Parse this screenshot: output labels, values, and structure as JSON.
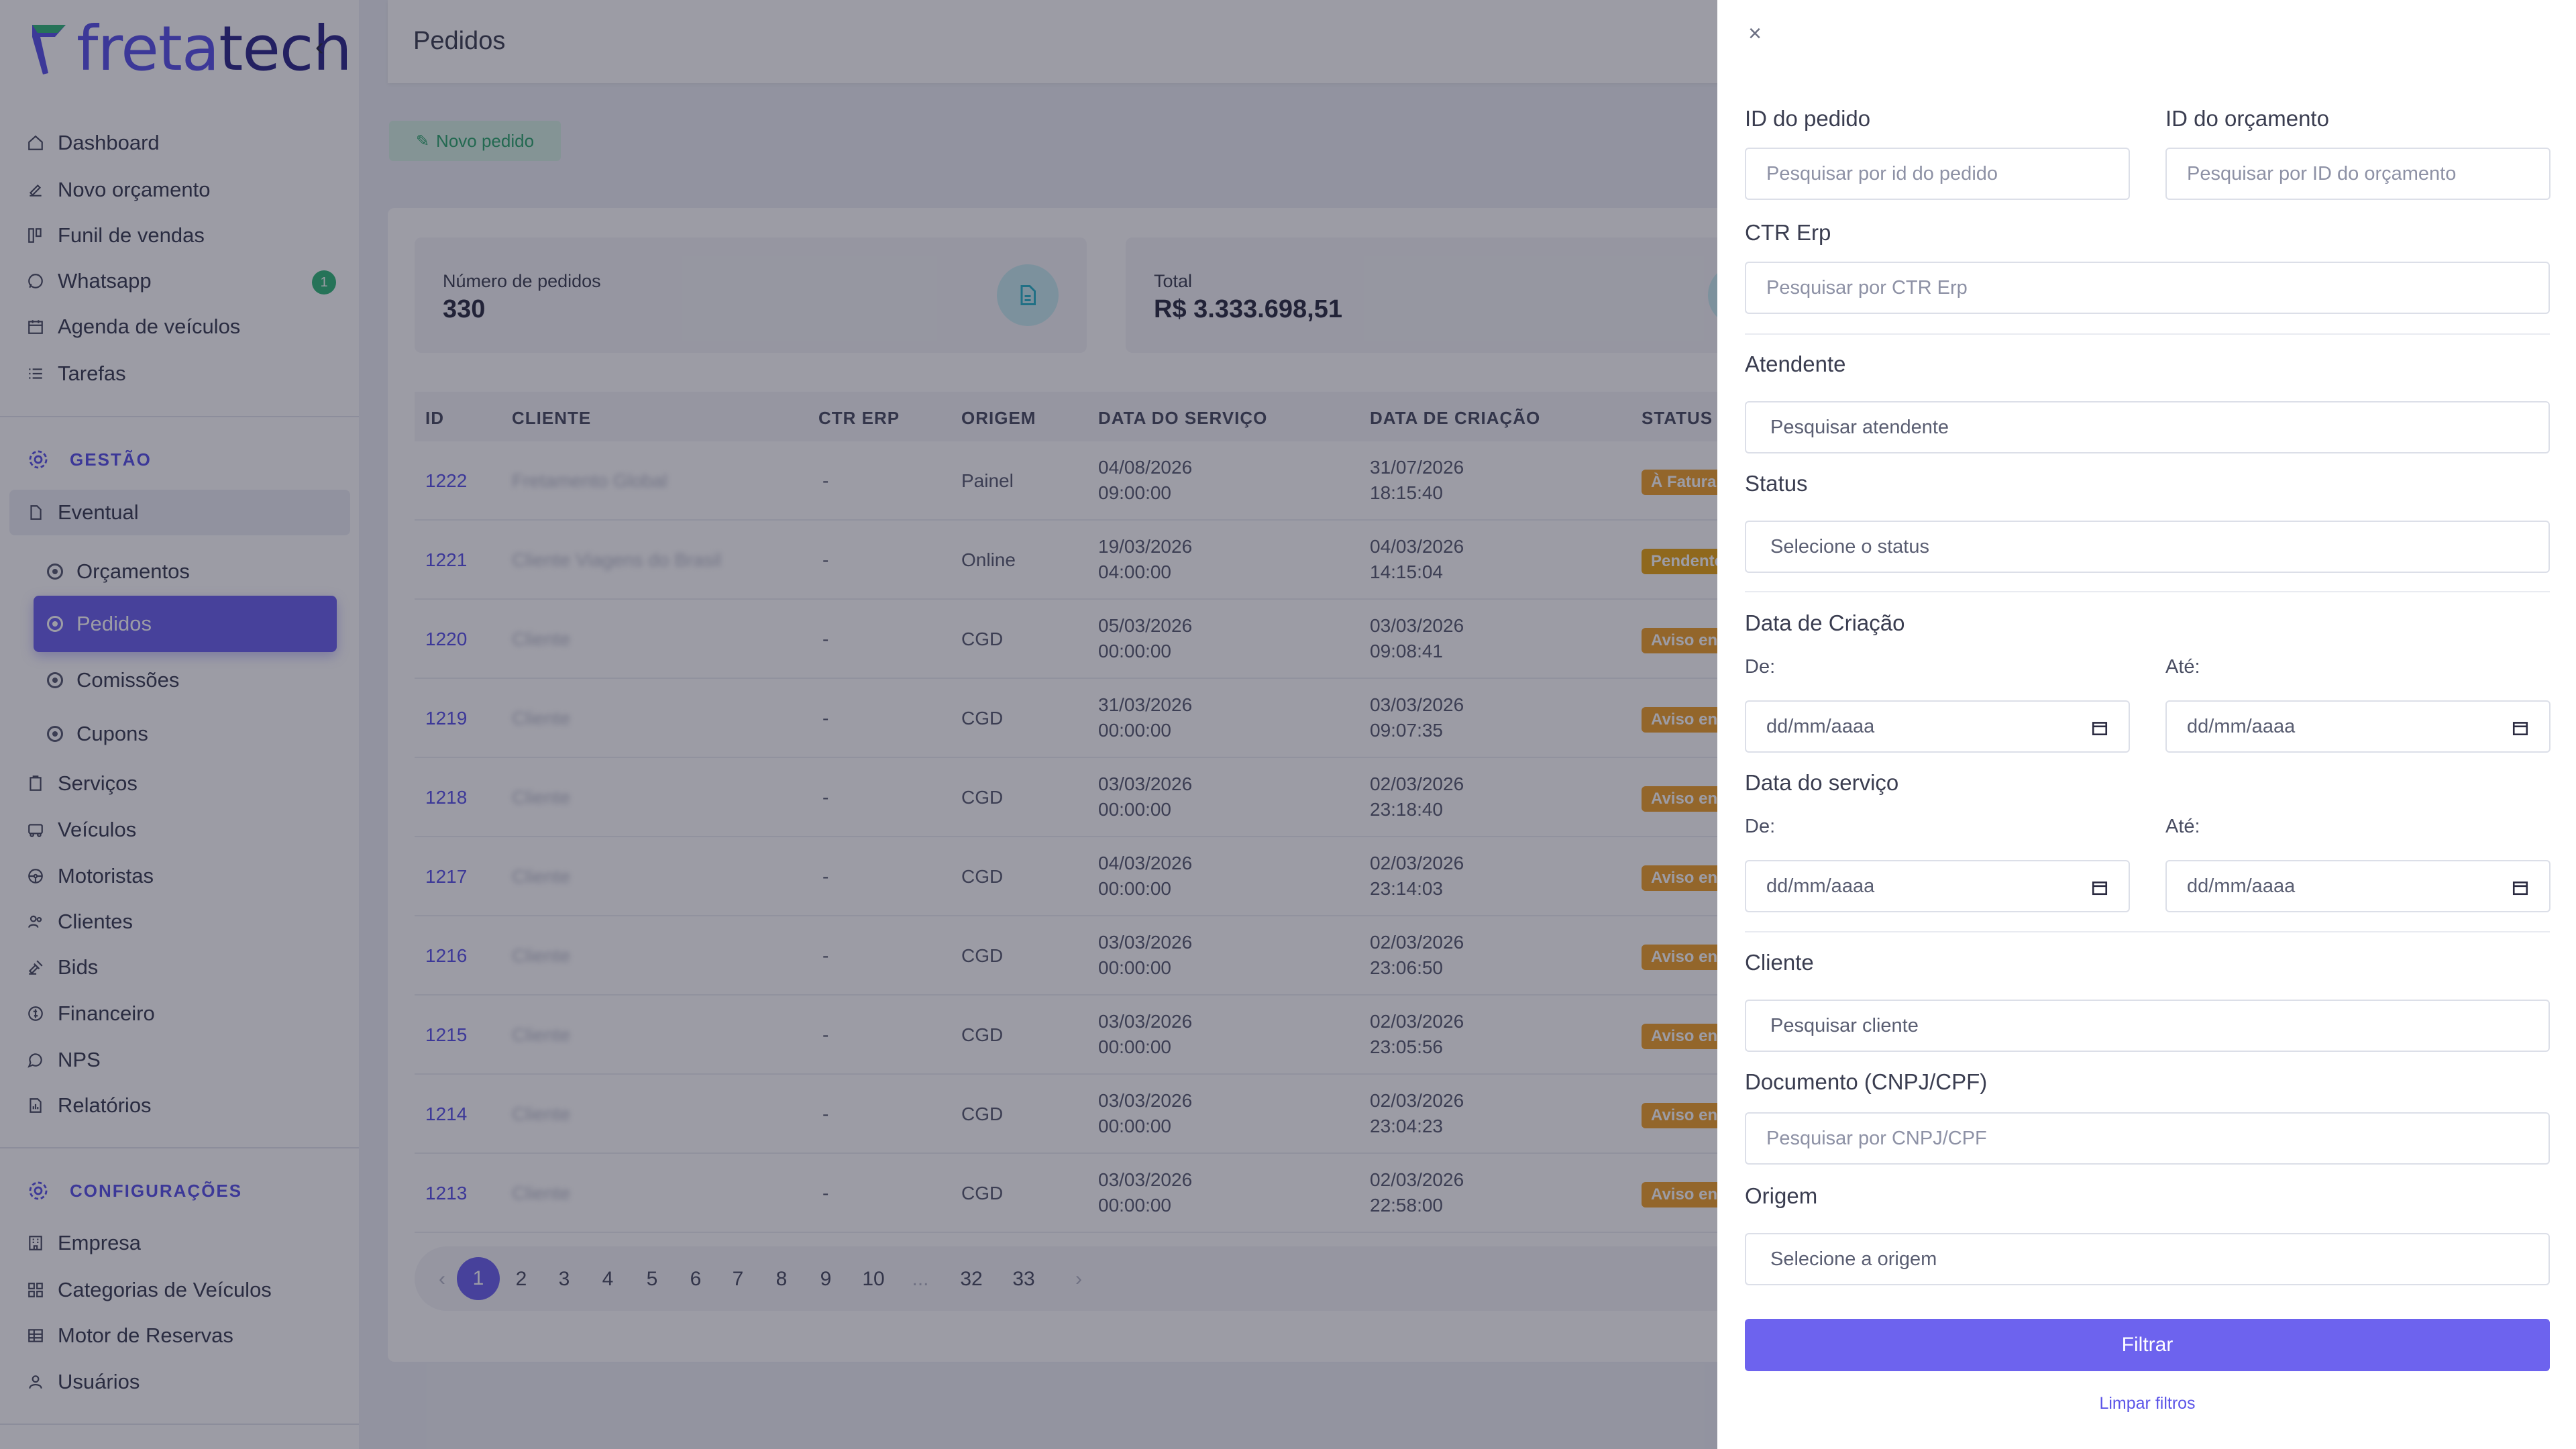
{
  "brand": {
    "name_part1": "freta",
    "name_part2": "tech",
    "colors": {
      "primary": "#5b54e8",
      "primary_dark": "#2f2a8a",
      "accent_green": "#35b87a",
      "status_orange": "#f0a22e",
      "status_yellow": "#e9a516"
    }
  },
  "sidebar": {
    "items": [
      {
        "label": "Dashboard",
        "icon": "home-icon"
      },
      {
        "label": "Novo orçamento",
        "icon": "edit-icon"
      },
      {
        "label": "Funil de vendas",
        "icon": "funnel-icon"
      },
      {
        "label": "Whatsapp",
        "icon": "whatsapp-icon",
        "badge": "1"
      },
      {
        "label": "Agenda de veículos",
        "icon": "calendar-icon"
      },
      {
        "label": "Tarefas",
        "icon": "list-icon"
      }
    ],
    "gestao_title": "GESTÃO",
    "eventual_label": "Eventual",
    "eventual_sub": [
      {
        "label": "Orçamentos"
      },
      {
        "label": "Pedidos",
        "active": true
      },
      {
        "label": "Comissões"
      },
      {
        "label": "Cupons"
      }
    ],
    "gestao_items": [
      {
        "label": "Serviços",
        "icon": "clipboard-icon"
      },
      {
        "label": "Veículos",
        "icon": "bus-icon"
      },
      {
        "label": "Motoristas",
        "icon": "steering-wheel-icon"
      },
      {
        "label": "Clientes",
        "icon": "users-icon"
      },
      {
        "label": "Bids",
        "icon": "gavel-icon"
      },
      {
        "label": "Financeiro",
        "icon": "coin-icon"
      },
      {
        "label": "NPS",
        "icon": "chat-icon"
      },
      {
        "label": "Relatórios",
        "icon": "report-icon"
      }
    ],
    "config_title": "CONFIGURAÇÕES",
    "config_items": [
      {
        "label": "Empresa",
        "icon": "building-icon"
      },
      {
        "label": "Categorias de Veículos",
        "icon": "grid-icon"
      },
      {
        "label": "Motor de Reservas",
        "icon": "table-icon"
      },
      {
        "label": "Usuários",
        "icon": "user-icon"
      }
    ]
  },
  "main": {
    "page_title": "Pedidos",
    "new_order_label": "Novo pedido",
    "stats": [
      {
        "label": "Número de pedidos",
        "value": "330"
      },
      {
        "label": "Total",
        "value": "R$ 3.333.698,51"
      }
    ],
    "columns": [
      "ID",
      "CLIENTE",
      "CTR ERP",
      "ORIGEM",
      "DATA DO SERVIÇO",
      "DATA DE CRIAÇÃO",
      "STATUS"
    ],
    "rows": [
      {
        "id": "1222",
        "client": "Fretamento Global",
        "ctr": "-",
        "origin": "Painel",
        "service_date": "04/08/2026",
        "service_time": "09:00:00",
        "created_date": "31/07/2026",
        "created_time": "18:15:40",
        "status": "À Faturar",
        "status_color": "#f0a22e"
      },
      {
        "id": "1221",
        "client": "Cliente Viagens do Brasil",
        "ctr": "-",
        "origin": "Online",
        "service_date": "19/03/2026",
        "service_time": "04:00:00",
        "created_date": "04/03/2026",
        "created_time": "14:15:04",
        "status": "Pendente",
        "status_color": "#e9a516"
      },
      {
        "id": "1220",
        "client": "Cliente",
        "ctr": "-",
        "origin": "CGD",
        "service_date": "05/03/2026",
        "service_time": "00:00:00",
        "created_date": "03/03/2026",
        "created_time": "09:08:41",
        "status": "Aviso enviado",
        "status_color": "#f0a22e"
      },
      {
        "id": "1219",
        "client": "Cliente",
        "ctr": "-",
        "origin": "CGD",
        "service_date": "31/03/2026",
        "service_time": "00:00:00",
        "created_date": "03/03/2026",
        "created_time": "09:07:35",
        "status": "Aviso enviado",
        "status_color": "#f0a22e"
      },
      {
        "id": "1218",
        "client": "Cliente",
        "ctr": "-",
        "origin": "CGD",
        "service_date": "03/03/2026",
        "service_time": "00:00:00",
        "created_date": "02/03/2026",
        "created_time": "23:18:40",
        "status": "Aviso enviado",
        "status_color": "#f0a22e"
      },
      {
        "id": "1217",
        "client": "Cliente",
        "ctr": "-",
        "origin": "CGD",
        "service_date": "04/03/2026",
        "service_time": "00:00:00",
        "created_date": "02/03/2026",
        "created_time": "23:14:03",
        "status": "Aviso enviado",
        "status_color": "#f0a22e"
      },
      {
        "id": "1216",
        "client": "Cliente",
        "ctr": "-",
        "origin": "CGD",
        "service_date": "03/03/2026",
        "service_time": "00:00:00",
        "created_date": "02/03/2026",
        "created_time": "23:06:50",
        "status": "Aviso enviado",
        "status_color": "#f0a22e"
      },
      {
        "id": "1215",
        "client": "Cliente",
        "ctr": "-",
        "origin": "CGD",
        "service_date": "03/03/2026",
        "service_time": "00:00:00",
        "created_date": "02/03/2026",
        "created_time": "23:05:56",
        "status": "Aviso enviado",
        "status_color": "#f0a22e"
      },
      {
        "id": "1214",
        "client": "Cliente",
        "ctr": "-",
        "origin": "CGD",
        "service_date": "03/03/2026",
        "service_time": "00:00:00",
        "created_date": "02/03/2026",
        "created_time": "23:04:23",
        "status": "Aviso enviado",
        "status_color": "#f0a22e"
      },
      {
        "id": "1213",
        "client": "Cliente",
        "ctr": "-",
        "origin": "CGD",
        "service_date": "03/03/2026",
        "service_time": "00:00:00",
        "created_date": "02/03/2026",
        "created_time": "22:58:00",
        "status": "Aviso enviado",
        "status_color": "#f0a22e"
      }
    ],
    "pagination": {
      "prev": "‹",
      "next": "›",
      "pages": [
        "1",
        "2",
        "3",
        "4",
        "5",
        "6",
        "7",
        "8",
        "9",
        "10",
        "...",
        "32",
        "33"
      ],
      "current": "1"
    }
  },
  "filter_drawer": {
    "close_label": "×",
    "order_id": {
      "label": "ID do pedido",
      "placeholder": "Pesquisar por id do pedido"
    },
    "budget_id": {
      "label": "ID do orçamento",
      "placeholder": "Pesquisar por ID do orçamento"
    },
    "ctr_erp": {
      "label": "CTR Erp",
      "placeholder": "Pesquisar por CTR Erp"
    },
    "attendant": {
      "label": "Atendente",
      "placeholder": "Pesquisar atendente"
    },
    "status": {
      "label": "Status",
      "placeholder": "Selecione o status"
    },
    "creation_date": {
      "label": "Data de Criação",
      "from_label": "De:",
      "to_label": "Até:",
      "from_placeholder": "dd/mm/aaaa",
      "to_placeholder": "dd/mm/aaaa"
    },
    "service_date": {
      "label": "Data do serviço",
      "from_label": "De:",
      "to_label": "Até:",
      "from_placeholder": "dd/mm/aaaa",
      "to_placeholder": "dd/mm/aaaa"
    },
    "client": {
      "label": "Cliente",
      "placeholder": "Pesquisar cliente"
    },
    "document": {
      "label": "Documento (CNPJ/CPF)",
      "placeholder": "Pesquisar por CNPJ/CPF"
    },
    "origin": {
      "label": "Origem",
      "placeholder": "Selecione a origem"
    },
    "filter_button": "Filtrar",
    "clear_link": "Limpar filtros"
  }
}
